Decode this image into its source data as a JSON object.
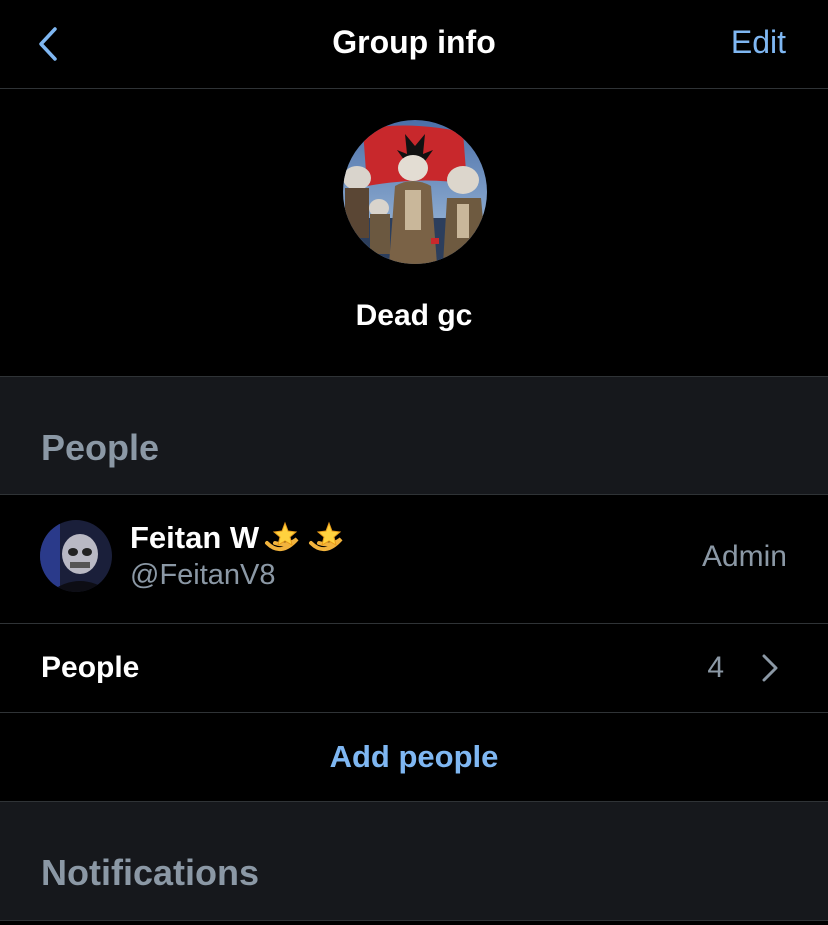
{
  "colors": {
    "accent": "#7fb7f2",
    "background": "#000000",
    "section_background": "#16181c",
    "divider": "#2f3336",
    "secondary_text": "#8b98a5"
  },
  "navbar": {
    "back_icon": "chevron-left-icon",
    "title": "Group info",
    "edit_label": "Edit"
  },
  "group": {
    "avatar_icon": "group-avatar-image",
    "name": "Dead gc"
  },
  "sections": {
    "people_title": "People",
    "notifications_title": "Notifications"
  },
  "members": [
    {
      "display_name": "Feitan W",
      "name_emoji": [
        "dizzy-star-icon",
        "dizzy-star-icon"
      ],
      "handle": "@FeitanV8",
      "role": "Admin"
    }
  ],
  "people_row": {
    "label": "People",
    "count": "4",
    "chevron_icon": "chevron-right-icon"
  },
  "add_people": {
    "label": "Add people"
  }
}
